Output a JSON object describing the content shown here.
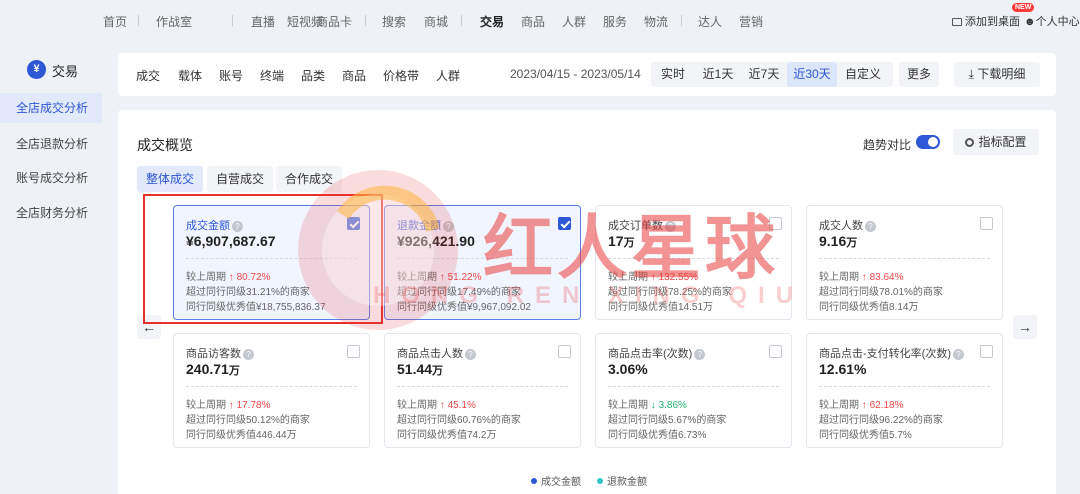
{
  "topnav": {
    "items": [
      "首页",
      "作战室",
      "直播",
      "短视频",
      "商品卡",
      "搜索",
      "商城",
      "交易",
      "商品",
      "人群",
      "服务",
      "物流",
      "达人",
      "营销"
    ],
    "active": "交易",
    "add_desktop": "添加到桌面",
    "new_badge": "NEW",
    "user_center": "个人中心"
  },
  "sidebar": {
    "logo_glyph": "¥",
    "title": "交易",
    "items": [
      {
        "label": "全店成交分析",
        "active": true
      },
      {
        "label": "全店退款分析",
        "active": false
      },
      {
        "label": "账号成交分析",
        "active": false
      },
      {
        "label": "全店财务分析",
        "active": false
      }
    ]
  },
  "filterbar": {
    "tabs": [
      "成交",
      "载体",
      "账号",
      "终端",
      "品类",
      "商品",
      "价格带",
      "人群"
    ],
    "date_range": "2023/04/15 - 2023/05/14",
    "periods": [
      "实时",
      "近1天",
      "近7天",
      "近30天",
      "自定义"
    ],
    "active_period": "近30天",
    "more": "更多",
    "download": "下载明细"
  },
  "panel": {
    "title": "成交概览",
    "trend_label": "趋势对比",
    "trend_on": true,
    "config_label": "指标配置",
    "subtabs": [
      "整体成交",
      "自营成交",
      "合作成交"
    ],
    "active_subtab": "整体成交"
  },
  "cards": [
    {
      "title": "成交金额",
      "value": "¥6,907,687.67",
      "unit": "",
      "checked": true,
      "selected": true,
      "compare_label": "较上周期",
      "arrow": "↑",
      "direction": "up",
      "change": "80.72%",
      "line2": "超过同行同级31.21%的商家",
      "line3": "同行同级优秀值¥18,755,836.37"
    },
    {
      "title": "退款金额",
      "value": "¥926,421.90",
      "unit": "",
      "checked": true,
      "selected": true,
      "compare_label": "较上周期",
      "arrow": "↑",
      "direction": "up",
      "change": "51.22%",
      "line2": "超过同行同级17.49%的商家",
      "line3": "同行同级优秀值¥9,967,092.02"
    },
    {
      "title": "成交订单数",
      "value": "17",
      "unit": "万",
      "checked": false,
      "selected": false,
      "compare_label": "较上周期",
      "arrow": "↑",
      "direction": "up",
      "change": "132.55%",
      "line2": "超过同行同级78.25%的商家",
      "line3": "同行同级优秀值14.51万"
    },
    {
      "title": "成交人数",
      "value": "9.16",
      "unit": "万",
      "checked": false,
      "selected": false,
      "compare_label": "较上周期",
      "arrow": "↑",
      "direction": "up",
      "change": "83.64%",
      "line2": "超过同行同级78.01%的商家",
      "line3": "同行同级优秀值8.14万"
    },
    {
      "title": "商品访客数",
      "value": "240.71",
      "unit": "万",
      "checked": false,
      "selected": false,
      "compare_label": "较上周期",
      "arrow": "↑",
      "direction": "up",
      "change": "17.78%",
      "line2": "超过同行同级50.12%的商家",
      "line3": "同行同级优秀值446.44万"
    },
    {
      "title": "商品点击人数",
      "value": "51.44",
      "unit": "万",
      "checked": false,
      "selected": false,
      "compare_label": "较上周期",
      "arrow": "↑",
      "direction": "up",
      "change": "45.1%",
      "line2": "超过同行同级60.76%的商家",
      "line3": "同行同级优秀值74.2万"
    },
    {
      "title": "商品点击率(次数)",
      "value": "3.06%",
      "unit": "",
      "checked": false,
      "selected": false,
      "compare_label": "较上周期",
      "arrow": "↓",
      "direction": "down",
      "change": "3.86%",
      "line2": "超过同行同级5.67%的商家",
      "line3": "同行同级优秀值6.73%"
    },
    {
      "title": "商品点击-支付转化率(次数)",
      "value": "12.61%",
      "unit": "",
      "checked": false,
      "selected": false,
      "compare_label": "较上周期",
      "arrow": "↑",
      "direction": "up",
      "change": "62.18%",
      "line2": "超过同行同级96.22%的商家",
      "line3": "同行同级优秀值5.7%"
    }
  ],
  "nav_arrows": {
    "prev": "←",
    "next": "→"
  },
  "legend": [
    {
      "label": "成交金额",
      "color": "#2e57d6"
    },
    {
      "label": "退款金额",
      "color": "#2ec5c5"
    }
  ],
  "watermark": {
    "text": "红人星球",
    "subtext": "HONG REN XING QIU"
  }
}
